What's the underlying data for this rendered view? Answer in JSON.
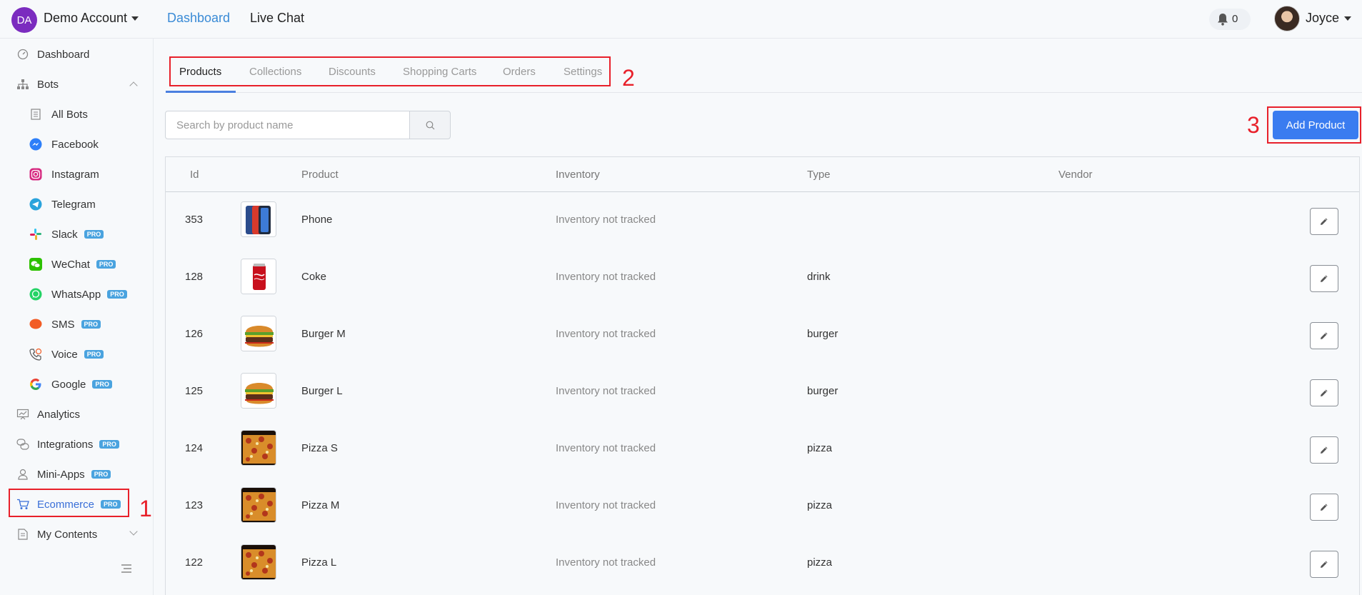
{
  "header": {
    "account_initials": "DA",
    "account_name": "Demo Account",
    "nav": [
      "Dashboard",
      "Live Chat"
    ],
    "notification_count": "0",
    "user_name": "Joyce"
  },
  "sidebar": {
    "items": [
      {
        "label": "Dashboard",
        "icon": "dashboard-icon"
      },
      {
        "label": "Bots",
        "icon": "sitemap-icon"
      },
      {
        "label": "All Bots",
        "icon": "document-icon"
      },
      {
        "label": "Facebook",
        "icon": "messenger-icon"
      },
      {
        "label": "Instagram",
        "icon": "instagram-icon"
      },
      {
        "label": "Telegram",
        "icon": "telegram-icon"
      },
      {
        "label": "Slack",
        "icon": "slack-icon",
        "badge": "PRO"
      },
      {
        "label": "WeChat",
        "icon": "wechat-icon",
        "badge": "PRO"
      },
      {
        "label": "WhatsApp",
        "icon": "whatsapp-icon",
        "badge": "PRO"
      },
      {
        "label": "SMS",
        "icon": "sms-icon",
        "badge": "PRO"
      },
      {
        "label": "Voice",
        "icon": "voice-icon",
        "badge": "PRO"
      },
      {
        "label": "Google",
        "icon": "google-icon",
        "badge": "PRO"
      },
      {
        "label": "Analytics",
        "icon": "analytics-icon"
      },
      {
        "label": "Integrations",
        "icon": "integrations-icon",
        "badge": "PRO"
      },
      {
        "label": "Mini-Apps",
        "icon": "user-icon",
        "badge": "PRO"
      },
      {
        "label": "Ecommerce",
        "icon": "cart-icon",
        "badge": "PRO"
      },
      {
        "label": "My Contents",
        "icon": "contents-icon"
      }
    ]
  },
  "annotations": [
    "1",
    "2",
    "3"
  ],
  "tabs": [
    "Products",
    "Collections",
    "Discounts",
    "Shopping Carts",
    "Orders",
    "Settings"
  ],
  "search": {
    "placeholder": "Search by product name"
  },
  "add_product_label": "Add Product",
  "table": {
    "columns": [
      "Id",
      "Product",
      "Inventory",
      "Type",
      "Vendor"
    ],
    "rows": [
      {
        "id": "353",
        "product": "Phone",
        "inventory": "Inventory not tracked",
        "type": "",
        "vendor": "",
        "thumb": "phone"
      },
      {
        "id": "128",
        "product": "Coke",
        "inventory": "Inventory not tracked",
        "type": "drink",
        "vendor": "",
        "thumb": "coke"
      },
      {
        "id": "126",
        "product": "Burger M",
        "inventory": "Inventory not tracked",
        "type": "burger",
        "vendor": "",
        "thumb": "burger"
      },
      {
        "id": "125",
        "product": "Burger L",
        "inventory": "Inventory not tracked",
        "type": "burger",
        "vendor": "",
        "thumb": "burger"
      },
      {
        "id": "124",
        "product": "Pizza S",
        "inventory": "Inventory not tracked",
        "type": "pizza",
        "vendor": "",
        "thumb": "pizza"
      },
      {
        "id": "123",
        "product": "Pizza M",
        "inventory": "Inventory not tracked",
        "type": "pizza",
        "vendor": "",
        "thumb": "pizza"
      },
      {
        "id": "122",
        "product": "Pizza L",
        "inventory": "Inventory not tracked",
        "type": "pizza",
        "vendor": "",
        "thumb": "pizza"
      }
    ]
  },
  "colors": {
    "accent": "#3a7cf0",
    "active_nav": "#3a8bd6",
    "highlight": "#e8202a",
    "pro_badge": "#4aa3df"
  }
}
